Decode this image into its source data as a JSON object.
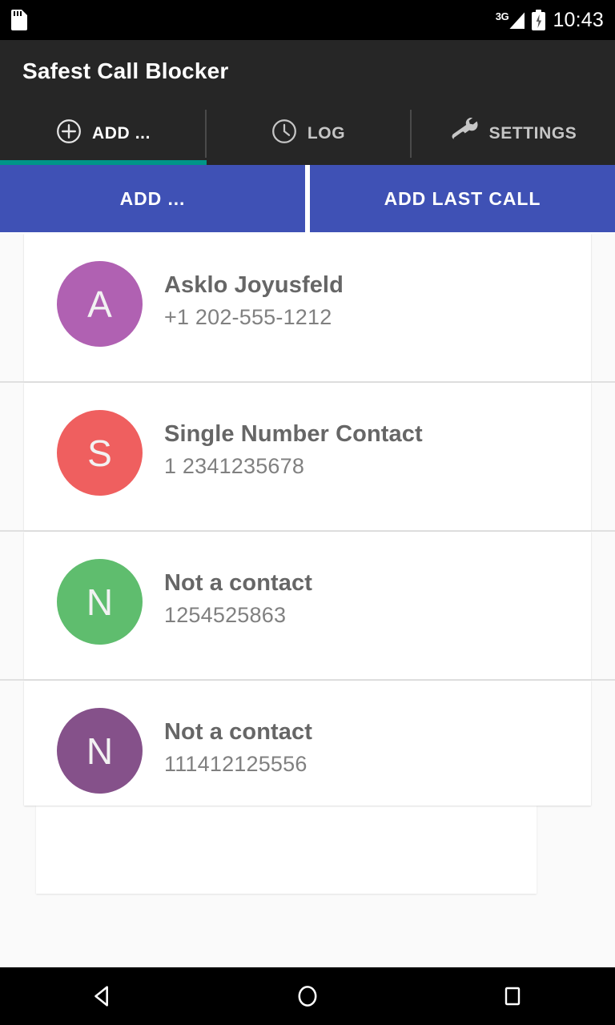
{
  "status_bar": {
    "sd_card_icon": "sd-card-icon",
    "network_label": "3G",
    "signal_icon": "signal-bars-icon",
    "battery_icon": "battery-charging-icon",
    "time": "10:43"
  },
  "app_bar": {
    "title": "Safest Call Blocker"
  },
  "tabs": [
    {
      "label": "ADD ...",
      "icon": "plus-circle-icon",
      "active": true
    },
    {
      "label": "LOG",
      "icon": "clock-icon",
      "active": false
    },
    {
      "label": "SETTINGS",
      "icon": "wrench-icon",
      "active": false
    }
  ],
  "action_buttons": [
    {
      "label": "ADD ..."
    },
    {
      "label": "ADD LAST CALL"
    }
  ],
  "contacts": [
    {
      "initial": "A",
      "name": "Asklo Joyusfeld",
      "number": "+1 202-555-1212",
      "avatar_color": "#b061b2"
    },
    {
      "initial": "S",
      "name": "Single Number Contact",
      "number": "1 2341235678",
      "avatar_color": "#ef5f5f"
    },
    {
      "initial": "N",
      "name": "Not a contact",
      "number": "1254525863",
      "avatar_color": "#5fbd6e"
    },
    {
      "initial": "N",
      "name": "Not a contact",
      "number": "111412125556",
      "avatar_color": "#85518a"
    }
  ],
  "nav_bar": {
    "back_icon": "back-triangle-icon",
    "home_icon": "home-circle-icon",
    "recents_icon": "recents-square-icon"
  },
  "colors": {
    "accent_teal": "#009688",
    "button_blue": "#3f51b5",
    "appbar_dark": "#262626",
    "page_bg": "#fafafa"
  }
}
